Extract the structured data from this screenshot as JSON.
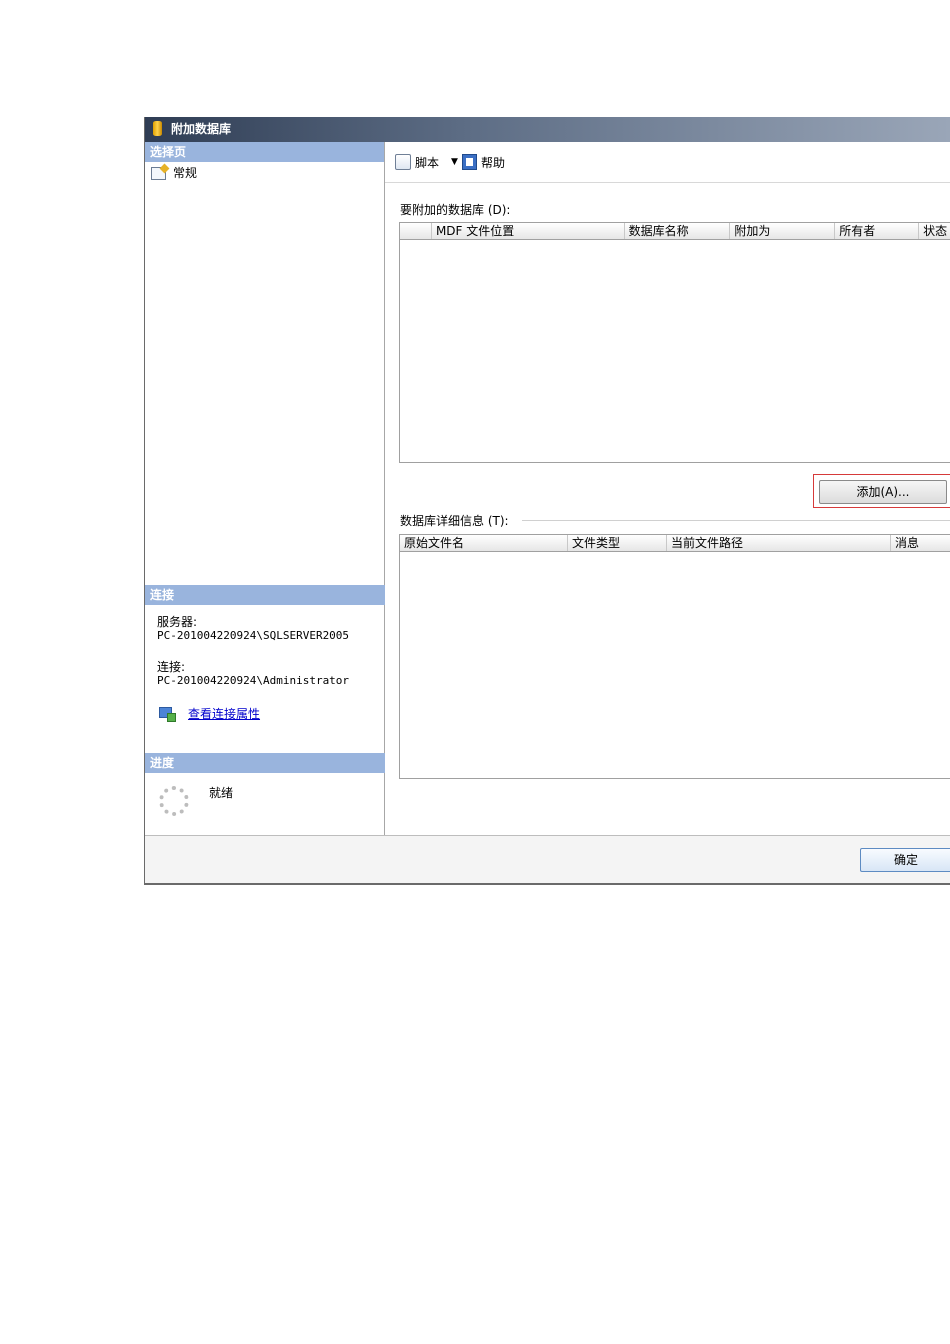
{
  "window": {
    "title": "附加数据库"
  },
  "left": {
    "select_page_header": "选择页",
    "pages": [
      {
        "label": "常规"
      }
    ],
    "connection_header": "连接",
    "server_label": "服务器:",
    "server_value": "PC-201004220924\\SQLSERVER2005",
    "connection_label": "连接:",
    "connection_value": "PC-201004220924\\Administrator",
    "view_connection_link": "查看连接属性",
    "progress_header": "进度",
    "progress_status": "就绪"
  },
  "toolbar": {
    "script_label": "脚本",
    "help_label": "帮助"
  },
  "attach_grid": {
    "label": "要附加的数据库 (D):",
    "columns": [
      "MDF 文件位置",
      "数据库名称",
      "附加为",
      "所有者",
      "状态"
    ]
  },
  "add_button_label": "添加(A)...",
  "details_grid": {
    "label": "数据库详细信息 (T):",
    "columns": [
      "原始文件名",
      "文件类型",
      "当前文件路径",
      "消息"
    ]
  },
  "footer": {
    "ok_label": "确定"
  }
}
